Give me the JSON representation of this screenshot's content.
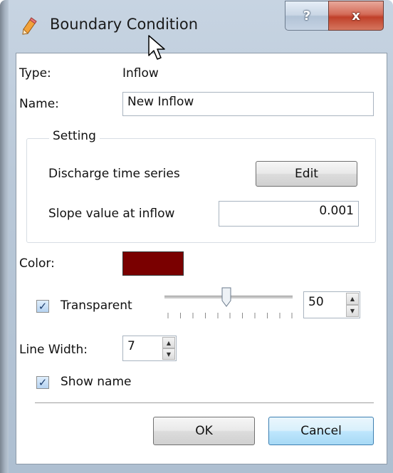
{
  "window": {
    "title": "Boundary Condition",
    "help_label": "?",
    "close_label": "x"
  },
  "form": {
    "type_label": "Type:",
    "type_value": "Inflow",
    "name_label": "Name:",
    "name_value": "New Inflow",
    "setting": {
      "title": "Setting",
      "discharge_label": "Discharge time series",
      "edit_label": "Edit",
      "slope_label": "Slope value at inflow",
      "slope_value": "0.001"
    },
    "color_label": "Color:",
    "color_value": "#7a0000",
    "transparent_label": "Transparent",
    "transparent_checked": true,
    "transparency_value": "50",
    "line_width_label": "Line Width:",
    "line_width_value": "7",
    "show_name_label": "Show name",
    "show_name_checked": true
  },
  "buttons": {
    "ok_label": "OK",
    "cancel_label": "Cancel"
  }
}
